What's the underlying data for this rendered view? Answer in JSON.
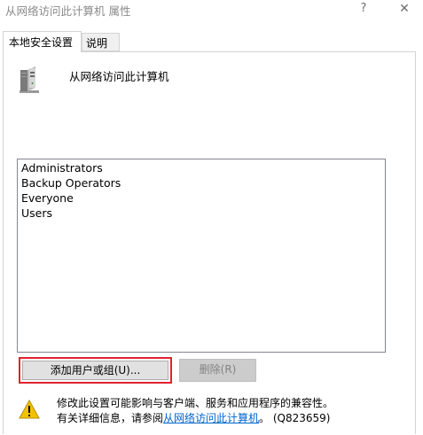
{
  "window": {
    "title": "从网络访问此计算机 属性",
    "help_glyph": "?",
    "close_glyph": "✕"
  },
  "tabs": [
    {
      "label": "本地安全设置",
      "active": true
    },
    {
      "label": "说明",
      "active": false
    }
  ],
  "policy": {
    "icon": "computer-tower-icon",
    "name": "从网络访问此计算机"
  },
  "members": [
    "Administrators",
    "Backup Operators",
    "Everyone",
    "Users"
  ],
  "buttons": {
    "add": "添加用户或组(U)...",
    "remove": "删除(R)"
  },
  "warning": {
    "icon": "warning-triangle-icon",
    "line1": "修改此设置可能影响与客户端、服务和应用程序的兼容性。",
    "line2_prefix": "有关详细信息，请参阅",
    "link_text": "从网络访问此计算机",
    "line2_suffix": "。 (Q823659)"
  },
  "colors": {
    "highlight_border": "#e0232e",
    "link": "#0066cc",
    "warning_yellow": "#f2c200"
  }
}
